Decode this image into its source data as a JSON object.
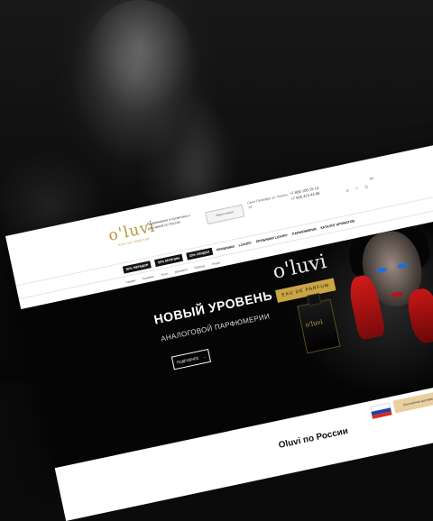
{
  "header": {
    "logo_word": "o'luvi",
    "logo_sub": "EAU DE PARFUM",
    "tagline": "Парфюмерия и косметика с доставкой по России",
    "small_button": "Задать вопрос",
    "address": "Санкт-Петербург, ул. Ленина, 14",
    "phone1": "+7 800 100 15 14",
    "phone2": "+7 925 474 44 86",
    "lang_note": "RU"
  },
  "nav": {
    "items": [
      {
        "label": "50% ЖЕНЩИН",
        "active": true
      },
      {
        "label": "50% МУЖЧИН",
        "active": true
      },
      {
        "label": "33% СКИДКИ",
        "active": true
      },
      {
        "label": "ПРОБНИКИ",
        "active": false
      },
      {
        "label": "LUXURY",
        "active": false
      },
      {
        "label": "ПРОБНИКИ LUXURY",
        "active": false
      },
      {
        "label": "ПАРФЮМЕРИЯ",
        "active": false
      },
      {
        "label": "КАТАЛОГ АРОМАТОВ",
        "active": false
      }
    ]
  },
  "subnav": {
    "items": [
      "Скидки",
      "Новинки",
      "Хиты",
      "Дешевле",
      "Бренды",
      "Акции"
    ]
  },
  "banner": {
    "headline": "НОВЫЙ УРОВЕНЬ",
    "subheadline": "АНАЛОГОВОЙ ПАРФЮМЕРИИ",
    "cta": "ПОДРОБНЕЕ",
    "brand": "o'luvi",
    "box_label": "EAU DE PARFUM",
    "bottle_label": "o'luvi",
    "accent_color": "#c9a544"
  },
  "footer_strip": {
    "delivery": "Oluvi по России",
    "gold_note": "Бесплатная доставка"
  }
}
